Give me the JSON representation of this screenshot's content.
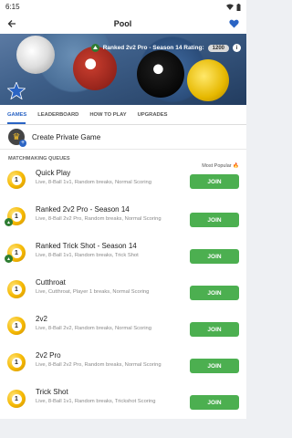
{
  "status": {
    "time": "6:15"
  },
  "appbar": {
    "title": "Pool",
    "back_icon": "back-arrow-icon",
    "favorite_icon": "heart-icon"
  },
  "hero": {
    "rating_text": "Ranked 2v2 Pro - Season 14 Rating:",
    "rating_value": "1200",
    "info": "i"
  },
  "tabs": [
    {
      "label": "GAMES",
      "active": true
    },
    {
      "label": "LEADERBOARD",
      "active": false
    },
    {
      "label": "HOW TO PLAY",
      "active": false
    },
    {
      "label": "UPGRADES",
      "active": false
    }
  ],
  "create": {
    "label": "Create Private Game"
  },
  "matchmaking": {
    "header": "MATCHMAKING QUEUES",
    "most_popular": "Most Popular",
    "join_label": "JOIN",
    "queues": [
      {
        "name": "Quick Play",
        "desc": "Live, 8-Ball 1v1, Random breaks, Normal Scoring"
      },
      {
        "name": "Ranked 2v2 Pro - Season 14",
        "desc": "Live, 8-Ball 2v2 Pro, Random breaks, Normal Scoring"
      },
      {
        "name": "Ranked Trick Shot - Season 14",
        "desc": "Live, 8-Ball 1v1, Random breaks, Trick Shot"
      },
      {
        "name": "Cutthroat",
        "desc": "Live, Cutthroat, Player 1 breaks, Normal Scoring"
      },
      {
        "name": "2v2",
        "desc": "Live, 8-Ball 2v2, Random breaks, Normal Scoring"
      },
      {
        "name": "2v2 Pro",
        "desc": "Live, 8-Ball 2v2 Pro, Random breaks, Normal Scoring"
      },
      {
        "name": "Trick Shot",
        "desc": "Live, 8-Ball 1v1, Random breaks, Trickshot Scoring"
      }
    ]
  }
}
